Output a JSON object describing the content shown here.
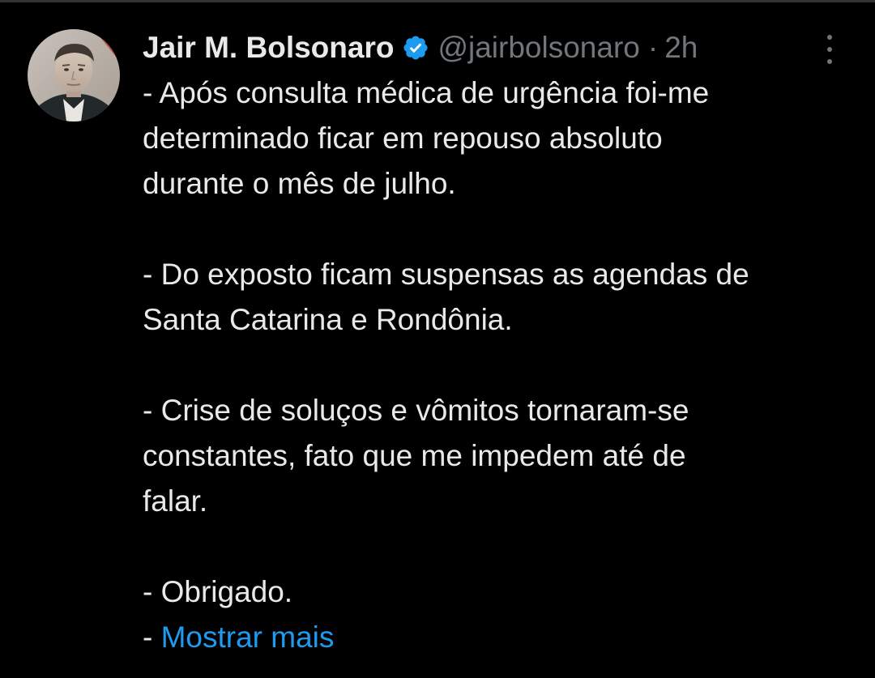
{
  "tweet": {
    "author": {
      "display_name": "Jair M. Bolsonaro",
      "handle": "@jairbolsonaro",
      "verified": true,
      "verified_icon": "verified-badge-icon",
      "avatar_icon": "profile-photo"
    },
    "separator": "·",
    "time": "2h",
    "more_icon": "more-options-icon",
    "paragraphs": [
      [
        "- Após consulta médica de urgência foi-me",
        "determinado ficar em repouso absoluto",
        "durante o mês de julho."
      ],
      [
        "- Do exposto ficam suspensas as agendas de",
        "Santa Catarina e Rondônia."
      ],
      [
        "- Crise de soluços e vômitos tornaram-se",
        "constantes, fato que me impedem até de",
        "falar."
      ],
      [
        "- Obrigado."
      ]
    ],
    "show_more": {
      "prefix": "- ",
      "label": "Mostrar mais"
    }
  },
  "colors": {
    "background": "#000000",
    "text_primary": "#e7e9ea",
    "text_secondary": "#71767b",
    "link": "#1d9bf0",
    "verified": "#1d9bf0",
    "divider": "#2f3336"
  }
}
